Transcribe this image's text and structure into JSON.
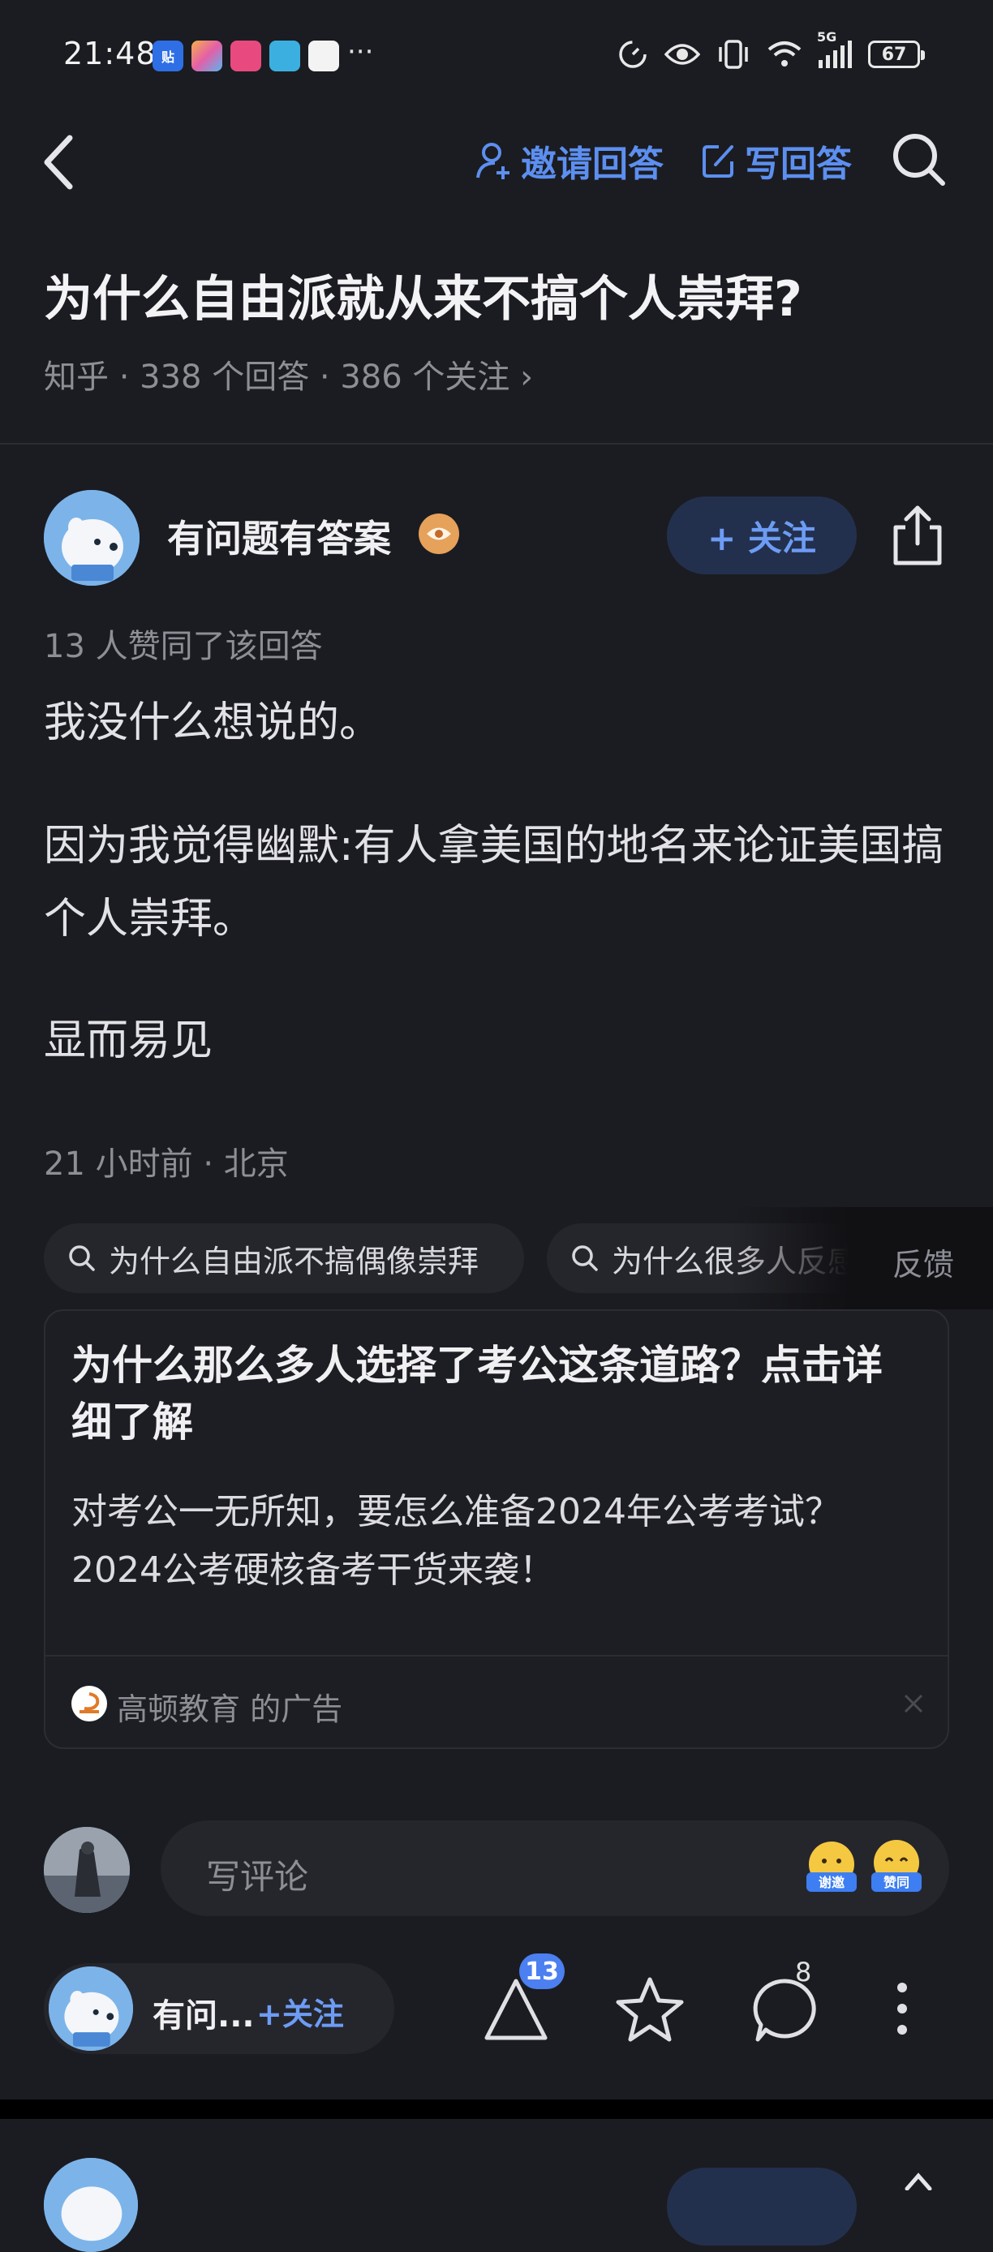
{
  "status_bar": {
    "time": "21:48",
    "apps": [
      "贴",
      "",
      "",
      "",
      ""
    ],
    "more": "···",
    "network": "5G",
    "battery": "67"
  },
  "nav": {
    "invite_label": "邀请回答",
    "write_label": "写回答"
  },
  "question": {
    "title": "为什么自由派就从来不搞个人崇拜?",
    "meta": "知乎 · 338 个回答 · 386 个关注 ›"
  },
  "author": {
    "name": "有问题有答案",
    "follow_label": "+ 关注"
  },
  "answer": {
    "votes": "13 人赞同了该回答",
    "paragraphs": [
      "我没什么想说的。",
      "因为我觉得幽默:有人拿美国的地名来论证美国搞个人崇拜。",
      "显而易见"
    ],
    "time_location": "21 小时前 · 北京"
  },
  "related": {
    "chips": [
      "为什么自由派不搞偶像崇拜",
      "为什么很多人反感"
    ],
    "feedback": "反馈"
  },
  "ad": {
    "title": "为什么那么多人选择了考公这条道路？点击详细了解",
    "desc": "对考公一无所知，要怎么准备2024年公考考试？2024公考硬核备考干货来袭！",
    "source": "高顿教育 的广告"
  },
  "comment": {
    "placeholder": "写评论",
    "emoji_thanks": "谢邀",
    "emoji_agree": "赞同"
  },
  "bottom_bar": {
    "author_short": "有问...",
    "follow_label": "+关注",
    "upvote_count": "13",
    "comment_count": "8"
  },
  "colors": {
    "background": "#1b1c21",
    "accent": "#5c8ff0",
    "muted_text": "#8d8e96"
  }
}
